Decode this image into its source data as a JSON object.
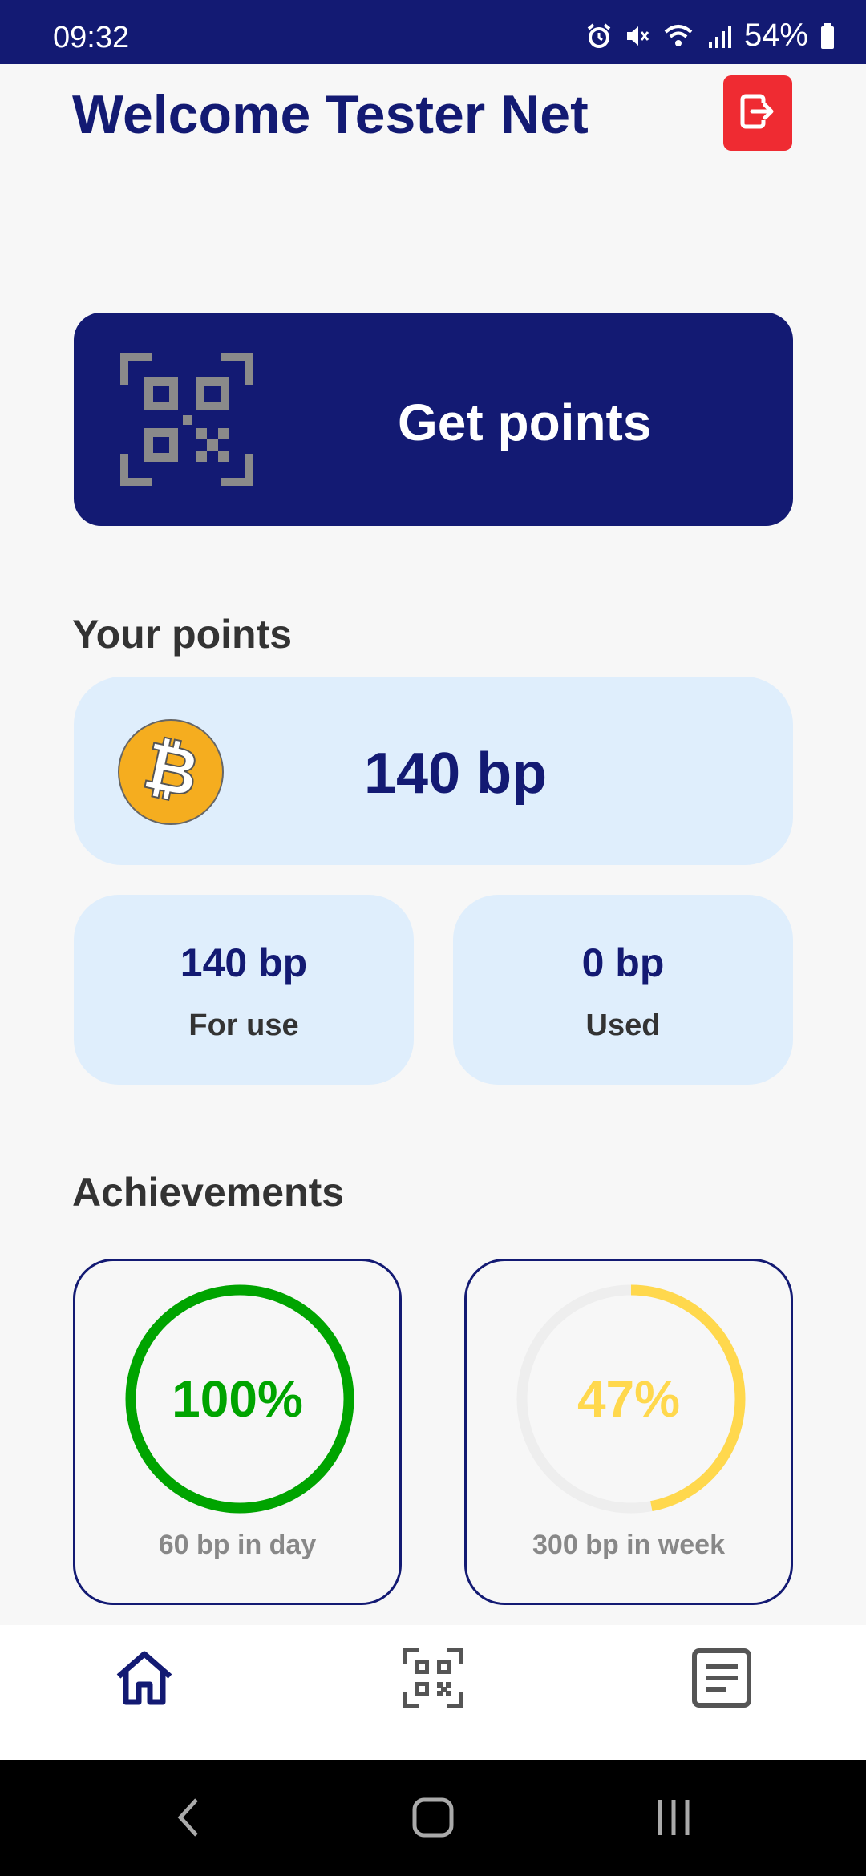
{
  "status_bar": {
    "time": "09:32",
    "battery": "54%",
    "icons": [
      "alarm-icon",
      "mute-icon",
      "wifi-icon",
      "signal-icon",
      "battery-icon"
    ]
  },
  "header": {
    "welcome": "Welcome Tester Net",
    "logout_icon": "logout-icon"
  },
  "get_points": {
    "label": "Get points",
    "icon": "qr-code-icon"
  },
  "points": {
    "section_title": "Your points",
    "total": "140 bp",
    "coin_icon": "bitcoin-icon",
    "for_use_value": "140 bp",
    "for_use_label": "For use",
    "used_value": "0 bp",
    "used_label": "Used"
  },
  "achievements": {
    "section_title": "Achievements",
    "items": [
      {
        "percent_text": "100%",
        "progress": 1.0,
        "label": "60 bp  in day",
        "color": "#00a400"
      },
      {
        "percent_text": "47%",
        "progress": 0.47,
        "label": "300 bp  in week",
        "color": "#ffd84d"
      }
    ]
  },
  "bottom_nav": {
    "items": [
      "home-icon",
      "qr-scan-icon",
      "history-icon"
    ],
    "active": "home-icon"
  },
  "colors": {
    "primary": "#131a73",
    "danger": "#ef2b32",
    "card": "#dfeefc",
    "coin": "#f5ad1f"
  }
}
